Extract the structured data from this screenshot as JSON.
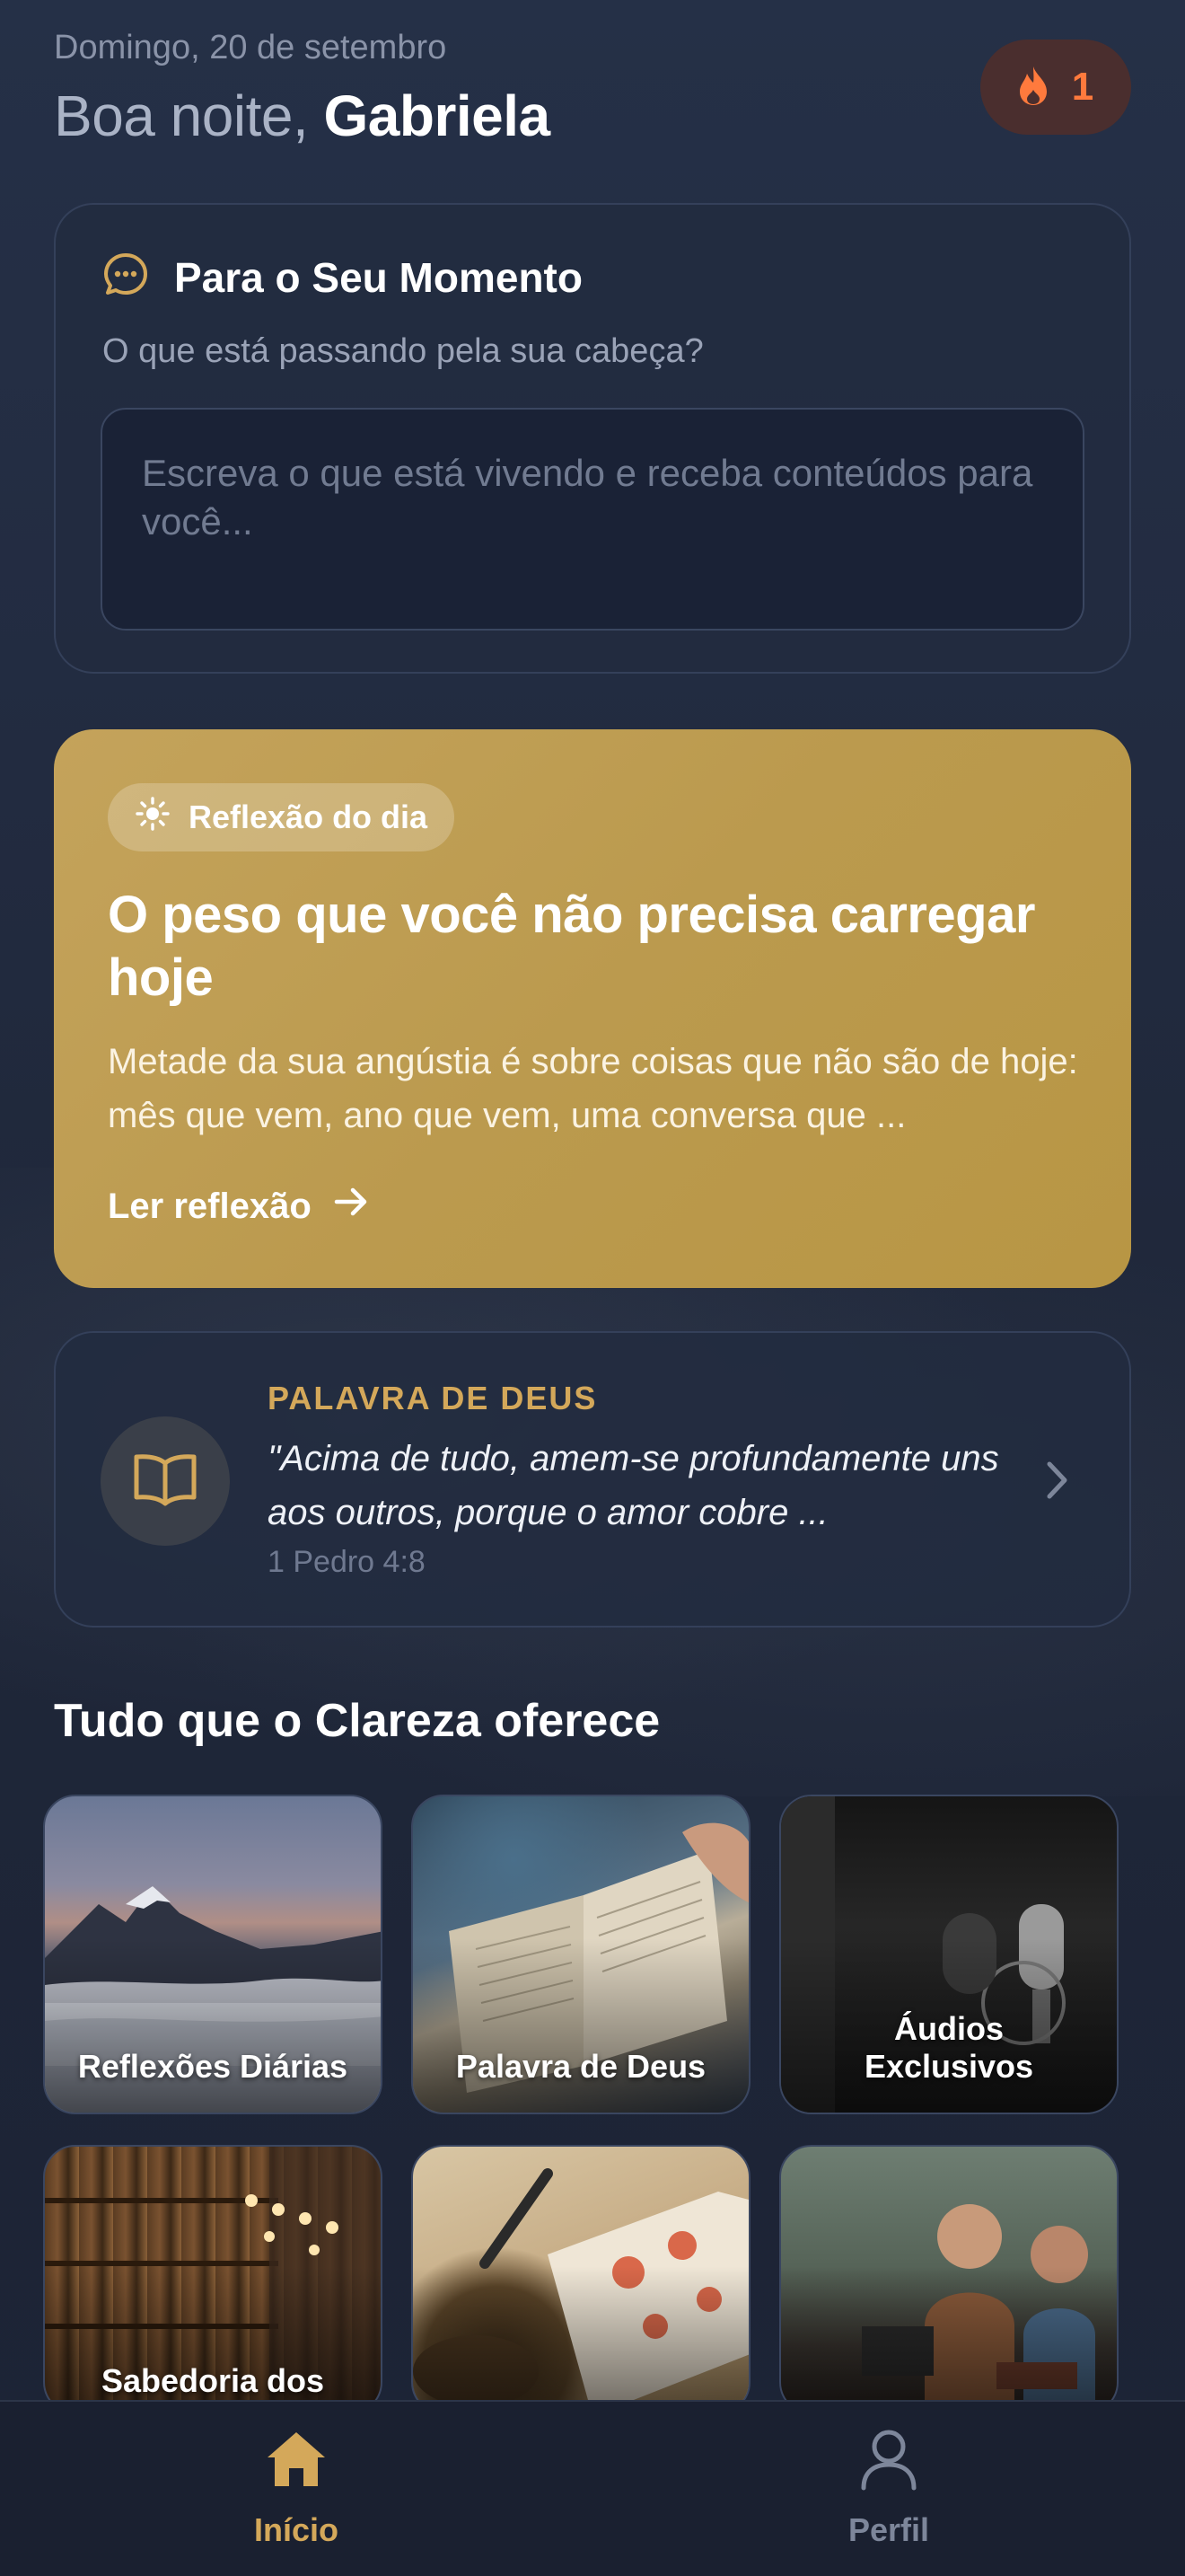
{
  "header": {
    "date": "Domingo, 20 de setembro",
    "greeting": "Boa noite, ",
    "user_name": "Gabriela",
    "streak_icon": "flame-icon",
    "streak_count": "1"
  },
  "moment_card": {
    "icon": "chat-bubble-icon",
    "title": "Para o Seu Momento",
    "subtitle": "O que está passando pela sua cabeça?",
    "input_placeholder": "Escreva o que está vivendo e receba conteúdos para você...",
    "input_value": ""
  },
  "reflection_card": {
    "badge_icon": "sun-icon",
    "badge_label": "Reflexão do dia",
    "title": "O peso que você não precisa carregar hoje",
    "excerpt": "Metade da sua angústia é sobre coisas que não são de hoje: mês que vem, ano que vem, uma conversa que ...",
    "action_label": "Ler reflexão",
    "background_color": "#c4a35b"
  },
  "verse_card": {
    "icon": "open-book-icon",
    "label": "PALAVRA DE DEUS",
    "quote": "\"Acima de tudo, amem-se profundamente uns aos outros, porque o amor cobre ...",
    "reference": "1 Pedro 4:8"
  },
  "features": {
    "title": "Tudo que o Clareza oferece",
    "items": [
      {
        "label": "Reflexões Diárias"
      },
      {
        "label": "Palavra de Deus"
      },
      {
        "label": "Áudios Exclusivos"
      },
      {
        "label": "Sabedoria dos"
      },
      {
        "label": ""
      },
      {
        "label": ""
      }
    ]
  },
  "bottom_nav": {
    "items": [
      {
        "label": "Início",
        "icon": "home-icon",
        "active": true
      },
      {
        "label": "Perfil",
        "icon": "user-icon",
        "active": false
      }
    ],
    "accent_color": "#d4a85a"
  }
}
